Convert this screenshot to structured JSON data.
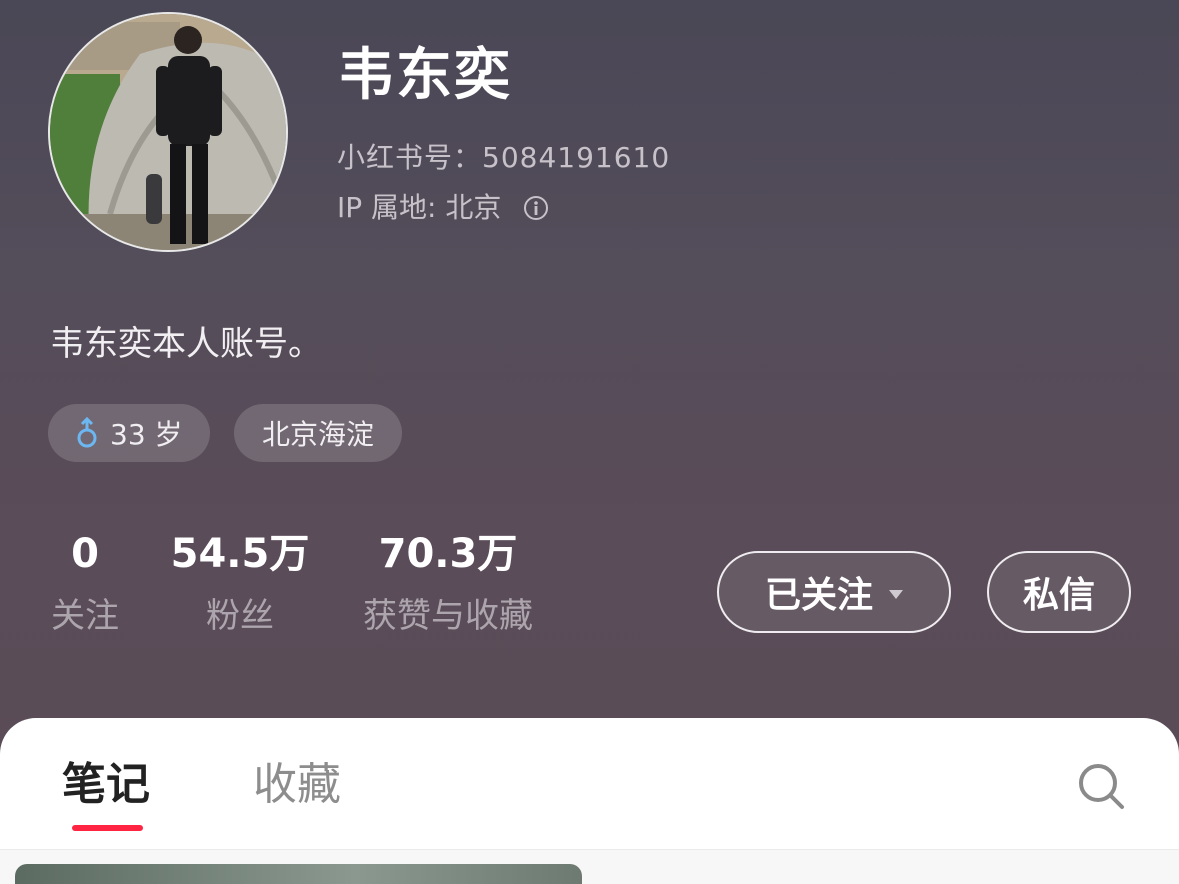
{
  "profile": {
    "name": "韦东奕",
    "id_line": "小红书号：5084191610",
    "ip_line": "IP 属地: 北京",
    "bio": "韦东奕本人账号。",
    "tags": {
      "age": "33 岁",
      "location": "北京海淀"
    }
  },
  "stats": [
    {
      "value": "0",
      "label": "关注"
    },
    {
      "value": "54.5万",
      "label": "粉丝"
    },
    {
      "value": "70.3万",
      "label": "获赞与收藏"
    }
  ],
  "buttons": {
    "follow": "已关注",
    "message": "私信"
  },
  "tabs": {
    "notes": "笔记",
    "collections": "收藏"
  },
  "colors": {
    "accent": "#ff2442",
    "male_icon": "#6cb7f2"
  },
  "icons": {
    "info": "info-icon",
    "gender": "male-icon",
    "search": "search-icon",
    "dropdown": "chevron-down-icon"
  }
}
